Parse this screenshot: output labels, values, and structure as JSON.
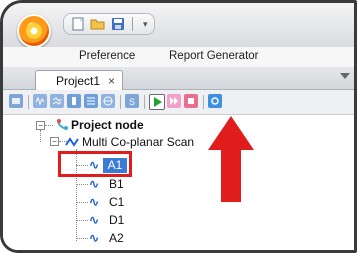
{
  "menu": {
    "preference": "Preference",
    "report_generator": "Report Generator"
  },
  "document_tab": {
    "label": "Project1",
    "close": "×"
  },
  "tree": {
    "root": "Project node",
    "scan": "Multi Co-planar Scan",
    "items": [
      "A1",
      "B1",
      "C1",
      "D1",
      "A2"
    ],
    "selected": "A1"
  },
  "colors": {
    "highlight": "#e01c1c",
    "selection": "#3b7bd8",
    "run_icon": "#1fa331"
  },
  "icons": [
    "app-orb-icon",
    "new-file-icon",
    "open-folder-icon",
    "save-icon",
    "run-icon",
    "pause-icon",
    "stop-icon",
    "red-arrow-icon"
  ]
}
